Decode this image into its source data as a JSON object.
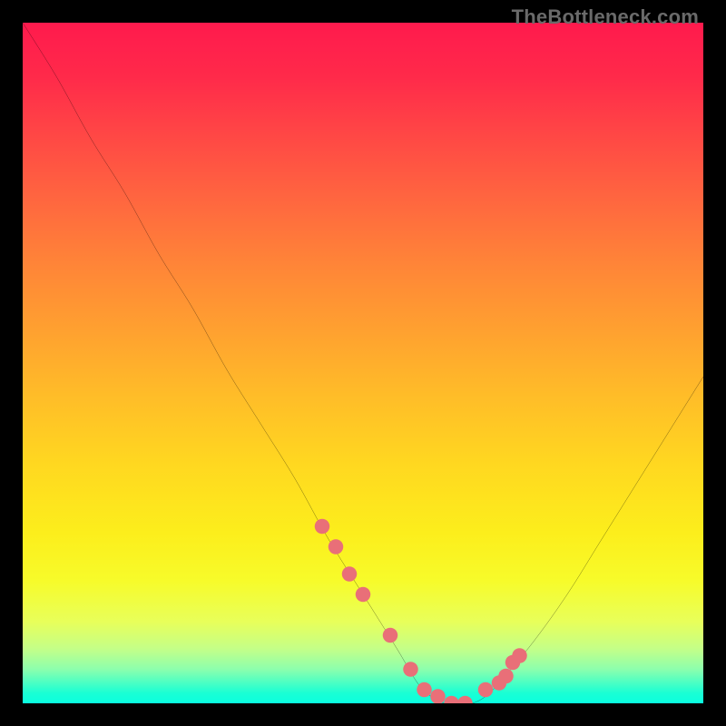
{
  "attribution": "TheBottleneck.com",
  "chart_data": {
    "type": "line",
    "title": "",
    "xlabel": "",
    "ylabel": "",
    "xlim": [
      0,
      100
    ],
    "ylim": [
      0,
      100
    ],
    "series": [
      {
        "name": "bottleneck-curve",
        "x": [
          0,
          5,
          10,
          15,
          20,
          25,
          30,
          35,
          40,
          45,
          50,
          55,
          58,
          60,
          62,
          64,
          66,
          68,
          70,
          75,
          80,
          85,
          90,
          95,
          100
        ],
        "values": [
          100,
          92,
          83,
          75,
          66,
          58,
          49,
          41,
          33,
          24,
          16,
          8,
          3,
          1,
          0,
          0,
          0,
          1,
          3,
          9,
          16,
          24,
          32,
          40,
          48
        ]
      }
    ],
    "markers": {
      "name": "highlight-dots",
      "x": [
        44,
        46,
        48,
        50,
        54,
        57,
        59,
        61,
        63,
        65,
        68,
        70,
        71,
        72,
        73
      ],
      "values": [
        26,
        23,
        19,
        16,
        10,
        5,
        2,
        1,
        0,
        0,
        2,
        3,
        4,
        6,
        7
      ]
    },
    "background_gradient": {
      "top_color": "#ff1a4d",
      "mid_color": "#ffd820",
      "bottom_color": "#1affd4"
    }
  }
}
